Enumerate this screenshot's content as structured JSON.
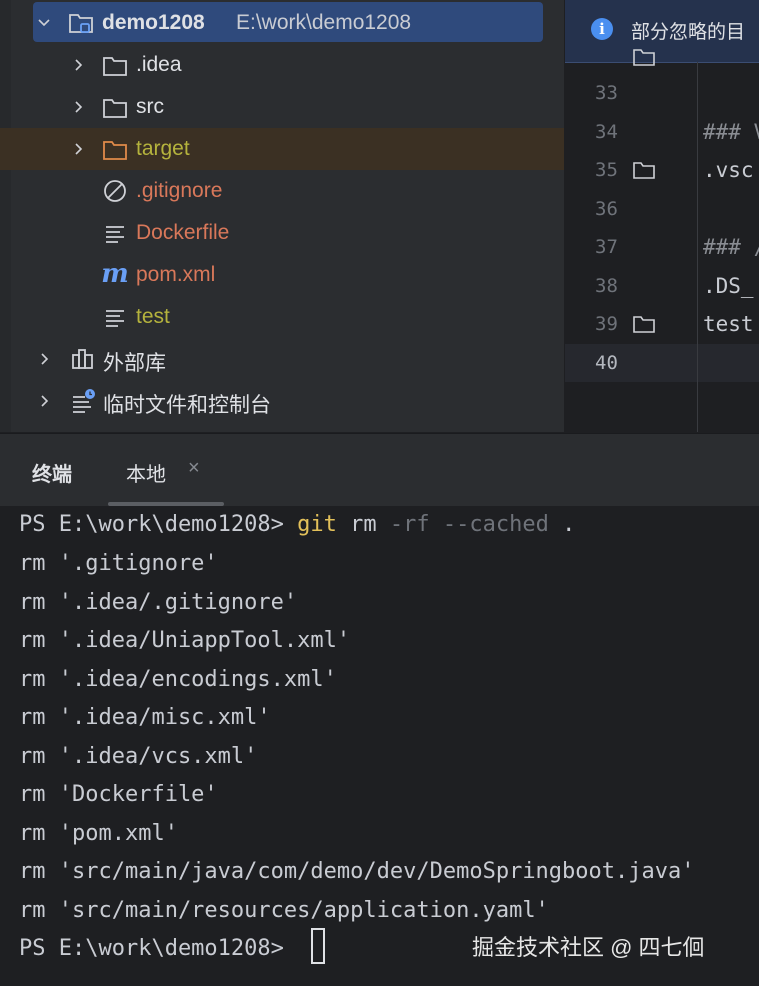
{
  "project_tree": {
    "root": {
      "name": "demo1208",
      "path": "E:\\work\\demo1208"
    },
    "items": [
      {
        "label": ".idea",
        "kind": "folder"
      },
      {
        "label": "src",
        "kind": "folder"
      },
      {
        "label": "target",
        "kind": "folder-excluded"
      },
      {
        "label": ".gitignore",
        "kind": "ignore-file"
      },
      {
        "label": "Dockerfile",
        "kind": "text-file"
      },
      {
        "label": "pom.xml",
        "kind": "maven-file"
      },
      {
        "label": "test",
        "kind": "text-file"
      },
      {
        "label": "外部库",
        "kind": "libraries"
      },
      {
        "label": "临时文件和控制台",
        "kind": "scratches"
      }
    ]
  },
  "editor": {
    "notice": "部分忽略的目",
    "line_numbers": [
      "33",
      "34",
      "35",
      "36",
      "37",
      "38",
      "39",
      "40"
    ],
    "current_line": "40",
    "code_lines": [
      "### V",
      ".vsc",
      "",
      "### /",
      ".DS_",
      "test",
      ""
    ]
  },
  "terminal": {
    "title": "终端",
    "tab_label": "本地",
    "tab_close": "×",
    "prompt": "PS E:\\work\\demo1208> ",
    "command_git": "git",
    "command_rm": " rm ",
    "command_flags": "-rf --cached",
    "command_arg": " .",
    "output": [
      "rm '.gitignore'",
      "rm '.idea/.gitignore'",
      "rm '.idea/UniappTool.xml'",
      "rm '.idea/encodings.xml'",
      "rm '.idea/misc.xml'",
      "rm '.idea/vcs.xml'",
      "rm 'Dockerfile'",
      "rm 'pom.xml'",
      "rm 'src/main/java/com/demo/dev/DemoSpringboot.java'",
      "rm 'src/main/resources/application.yaml'"
    ],
    "final_prompt": "PS E:\\work\\demo1208>"
  },
  "watermark": "掘金技术社区 @ 四七佪",
  "colors": {
    "tree_bg": "#2b2d30",
    "editor_bg": "#1e1f22",
    "selection": "#2f4a7c",
    "excluded_bg": "#3b3023",
    "vcs_untracked": "#d9785a",
    "vcs_ignored": "#b5b33d",
    "git_command": "#e2c05a"
  }
}
